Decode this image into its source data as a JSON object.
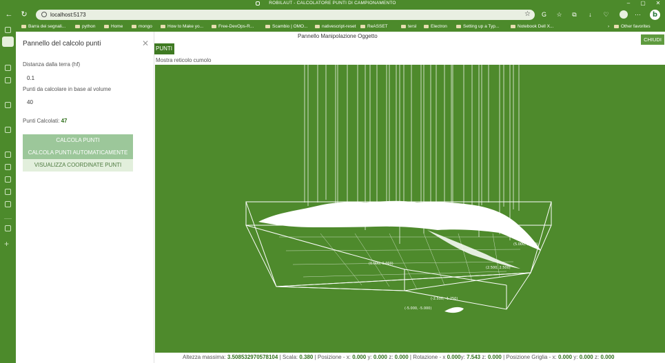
{
  "window": {
    "title": "ROBILAUT - CALCOLATORE PUNTI DI CAMPIONAMENTO"
  },
  "browser": {
    "url": "localhost:5173",
    "bookmarks": [
      "Barra dei segnali...",
      "python",
      "Home",
      "mongo",
      "How to Make yo...",
      "Free-DevOps-R...",
      "Scambio | OMO...",
      "nativescript-reset",
      "ReASSET",
      "tersl",
      "Electron",
      "Setting up a Typ...",
      "Notebook Dell X..."
    ],
    "other_favorites": "Other favorites",
    "accent_color": "#4c8a2b"
  },
  "panel": {
    "title": "Pannello del calcolo punti",
    "close_glyph": "✕",
    "distance_label": "Distanza dalla terra (hf)",
    "distance_value": "0.1",
    "points_label": "Punti da calcolare in base al volume",
    "points_value": "40",
    "calculated_label": "Punti Calcolati:",
    "calculated_value": "47",
    "btn_calc": "CALCOLA PUNTI",
    "btn_auto": "CALCOLA PUNTI AUTOMATICAMENTE",
    "btn_view": "VISUALIZZA COORDINATE PUNTI"
  },
  "main": {
    "title": "Pannello Manipolazione Oggetto",
    "punti_button": "PUNTI",
    "close_button": "CHIUDI",
    "grid_toggle": "Mostra reticolo cumolo",
    "viewport_color": "#4e8a2c",
    "grid_labels": [
      "(-5.000, -5.000)",
      "(-2.500, -1.250)",
      "(0.000, 0.000)",
      "(2.500, 2.500)",
      "(5.000, 5.000)"
    ]
  },
  "status": {
    "max_height_label": "Altezza massima:",
    "max_height_value": "3.508532970578104",
    "scale_label": "| Scala:",
    "scale_value": "0.380",
    "pos_label": "| Posizione - x:",
    "pos_x": "0.000",
    "pos_y_label": "y:",
    "pos_y": "0.000",
    "pos_z_label": "z:",
    "pos_z": "0.000",
    "rot_label": "| Rotazione - x",
    "rot_x": "0.000",
    "rot_y_label": "y:",
    "rot_y": "7.543",
    "rot_z_label": "z:",
    "rot_z": "0.000",
    "grid_label": "| Posizione Griglia - x:",
    "grid_x": "0.000",
    "grid_y_label": "y:",
    "grid_y": "0.000",
    "grid_z_label": "z:",
    "grid_z": "0.000"
  }
}
